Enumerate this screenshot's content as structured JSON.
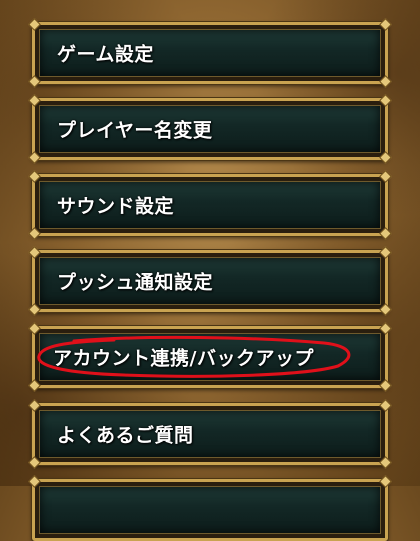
{
  "menu": {
    "items": [
      {
        "label": "ゲーム設定"
      },
      {
        "label": "プレイヤー名変更"
      },
      {
        "label": "サウンド設定"
      },
      {
        "label": "プッシュ通知設定"
      },
      {
        "label": "アカウント連携/バックアップ"
      },
      {
        "label": "よくあるご質問"
      },
      {
        "label": ""
      }
    ]
  },
  "colors": {
    "frame_gold": "#c9a351",
    "panel_dark_green": "#132826",
    "background_parchment": "#8d6530",
    "annotation_red": "#e0101a"
  }
}
